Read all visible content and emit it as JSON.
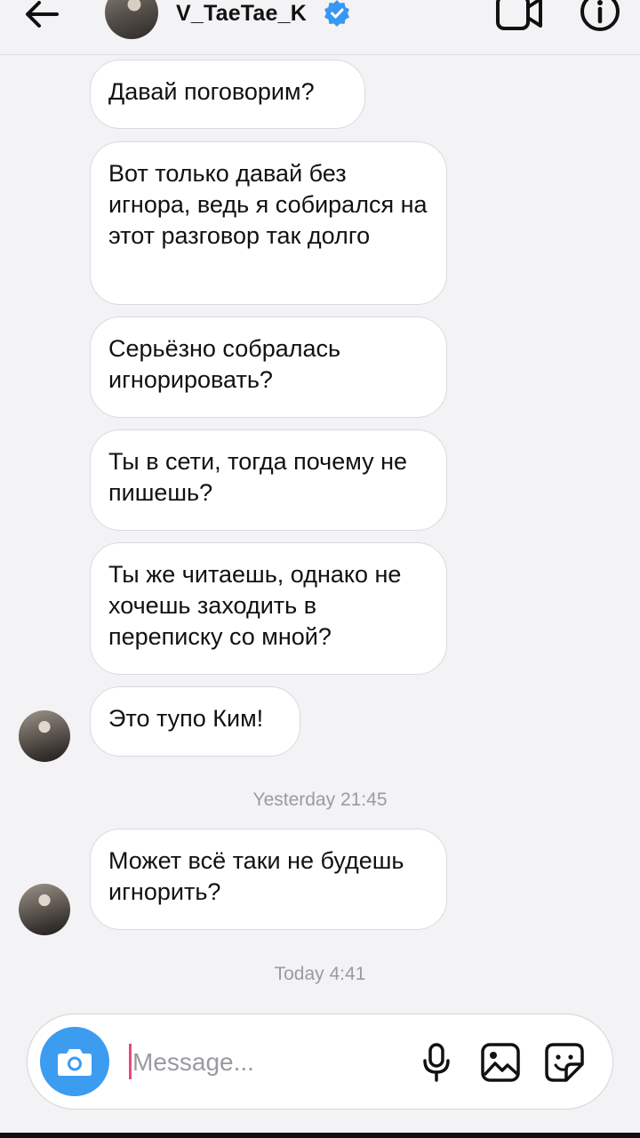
{
  "header": {
    "username": "V_TaeTae_K",
    "back_icon": "arrow-left-icon",
    "verified_icon": "verified-badge-icon",
    "video_icon": "video-camera-icon",
    "info_icon": "info-icon"
  },
  "messages": [
    {
      "text": "Давай поговорим?"
    },
    {
      "text": "Вот только давай без игнора, ведь я собирался на этот разговор так долго"
    },
    {
      "text": "Серьёзно собралась игнорировать?"
    },
    {
      "text": "Ты в сети, тогда почему не пишешь?"
    },
    {
      "text": "Ты же читаешь, однако не хочешь заходить в переписку со мной?"
    },
    {
      "text": "Это тупо Ким!"
    },
    {
      "text": "Может всё таки не будешь игнорить?"
    }
  ],
  "timestamps": [
    "Yesterday 21:45",
    "Today 4:41"
  ],
  "composer": {
    "placeholder": "Message...",
    "value": "",
    "camera_icon": "camera-icon",
    "mic_icon": "microphone-icon",
    "gallery_icon": "image-gallery-icon",
    "sticker_icon": "sticker-icon"
  },
  "colors": {
    "accent": "#3c9cf0",
    "verified": "#3897f0",
    "caret": "#e64a7a",
    "background": "#f3f3f5"
  }
}
